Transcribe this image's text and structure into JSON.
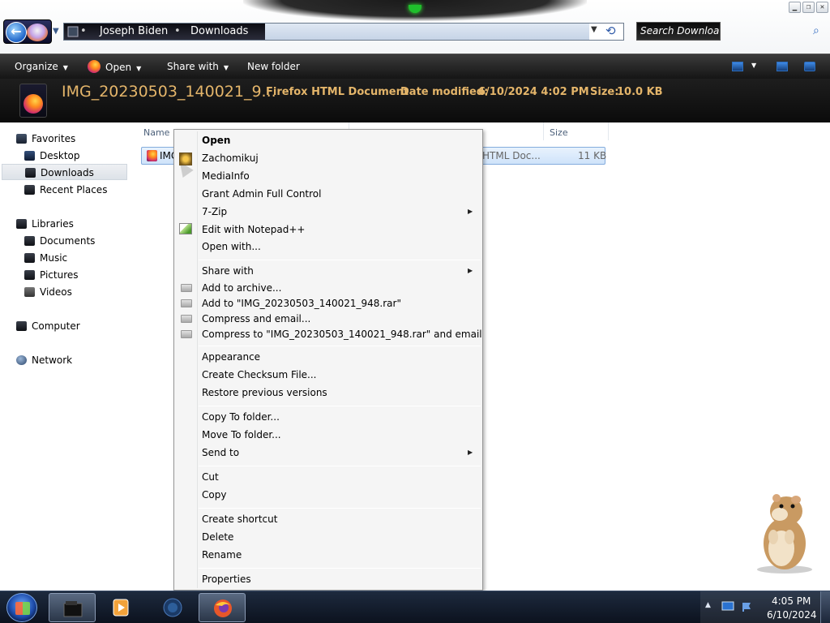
{
  "window": {
    "minimize": "▁",
    "maximize": "❐",
    "close": "✕"
  },
  "address": {
    "crumbs": [
      "Joseph Biden",
      "Downloads"
    ],
    "separator": "•"
  },
  "search": {
    "placeholder": "Search Downloads"
  },
  "toolbar": {
    "organize": "Organize",
    "open": "Open",
    "share_with": "Share with",
    "new_folder": "New folder"
  },
  "details": {
    "file_name": "IMG_20230503_140021_9...",
    "file_type": "Firefox HTML Document",
    "date_label": "Date modified:",
    "date_value": "6/10/2024 4:02 PM",
    "size_label": "Size:",
    "size_value": "10.0 KB"
  },
  "nav": {
    "favorites": "Favorites",
    "desktop": "Desktop",
    "downloads": "Downloads",
    "recent_places": "Recent Places",
    "libraries": "Libraries",
    "documents": "Documents",
    "music": "Music",
    "pictures": "Pictures",
    "videos": "Videos",
    "computer": "Computer",
    "network": "Network"
  },
  "columns": {
    "name": "Name",
    "size": "Size"
  },
  "file": {
    "name_visible": "IMG",
    "type_visible": "HTML Doc...",
    "size": "11 KB"
  },
  "context_menu": {
    "open": "Open",
    "zachomikuj": "Zachomikuj",
    "mediainfo": "MediaInfo",
    "grant_admin": "Grant Admin Full Control",
    "seven_zip": "7-Zip",
    "edit_notepad": "Edit with Notepad++",
    "open_with": "Open with...",
    "share_with": "Share with",
    "add_archive": "Add to archive...",
    "add_to_rar": "Add to \"IMG_20230503_140021_948.rar\"",
    "compress_email": "Compress and email...",
    "compress_to_rar_email": "Compress to \"IMG_20230503_140021_948.rar\" and email",
    "appearance": "Appearance",
    "create_checksum": "Create Checksum File...",
    "restore_versions": "Restore previous versions",
    "copy_to_folder": "Copy To folder...",
    "move_to_folder": "Move To folder...",
    "send_to": "Send to",
    "cut": "Cut",
    "copy": "Copy",
    "create_shortcut": "Create shortcut",
    "delete": "Delete",
    "rename": "Rename",
    "properties": "Properties"
  },
  "taskbar": {
    "time": "4:05 PM",
    "date": "6/10/2024",
    "tray_arrow": "▲"
  },
  "colors": {
    "details_text": "#e4b56a",
    "toolbar_bg": "#1c1c1c",
    "selection": "#cfe3fa"
  }
}
